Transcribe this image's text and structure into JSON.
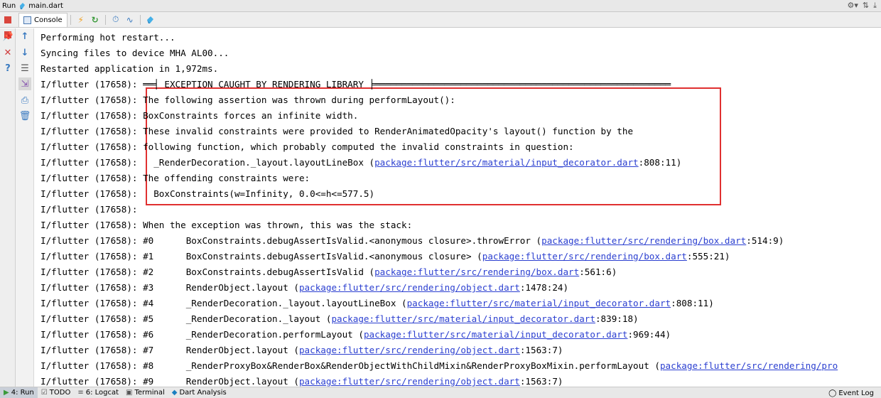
{
  "titlebar": {
    "run_label": "Run",
    "file_label": "main.dart",
    "icons": [
      "gear-icon",
      "split-icon",
      "minimize-icon"
    ]
  },
  "toolbar": {
    "console_tab": "Console",
    "buttons": [
      "flash-icon",
      "hot-restart-icon",
      "timer-icon",
      "performance-icon",
      "dart-devtools-icon"
    ]
  },
  "gutter_left": [
    "stop-icon",
    "pin-icon",
    "close-icon",
    "help-icon"
  ],
  "gutter_right": [
    "up-arrow-icon",
    "down-arrow-icon",
    "soft-wrap-icon",
    "scroll-end-icon",
    "print-icon",
    "trash-icon"
  ],
  "console_lines": [
    {
      "text": "Performing hot restart..."
    },
    {
      "text": "Syncing files to device MHA AL00..."
    },
    {
      "text": "Restarted application in 1,972ms."
    },
    {
      "prefix": "I/flutter (17658): ",
      "text": "══╡ EXCEPTION CAUGHT BY RENDERING LIBRARY ╞═══════════════════════════════════════════════════════"
    },
    {
      "prefix": "I/flutter (17658): ",
      "text": "The following assertion was thrown during performLayout():"
    },
    {
      "prefix": "I/flutter (17658): ",
      "text": "BoxConstraints forces an infinite width."
    },
    {
      "prefix": "I/flutter (17658): ",
      "text": "These invalid constraints were provided to RenderAnimatedOpacity's layout() function by the"
    },
    {
      "prefix": "I/flutter (17658): ",
      "text": "following function, which probably computed the invalid constraints in question:"
    },
    {
      "prefix": "I/flutter (17658): ",
      "text": "  _RenderDecoration._layout.layoutLineBox (",
      "link": "package:flutter/src/material/input_decorator.dart",
      "suffix": ":808:11)"
    },
    {
      "prefix": "I/flutter (17658): ",
      "text": "The offending constraints were:"
    },
    {
      "prefix": "I/flutter (17658): ",
      "text": "  BoxConstraints(w=Infinity, 0.0<=h<=577.5)"
    },
    {
      "prefix": "I/flutter (17658): ",
      "text": ""
    },
    {
      "prefix": "I/flutter (17658): ",
      "text": "When the exception was thrown, this was the stack:"
    },
    {
      "prefix": "I/flutter (17658): ",
      "text": "#0      BoxConstraints.debugAssertIsValid.<anonymous closure>.throwError (",
      "link": "package:flutter/src/rendering/box.dart",
      "suffix": ":514:9)"
    },
    {
      "prefix": "I/flutter (17658): ",
      "text": "#1      BoxConstraints.debugAssertIsValid.<anonymous closure> (",
      "link": "package:flutter/src/rendering/box.dart",
      "suffix": ":555:21)"
    },
    {
      "prefix": "I/flutter (17658): ",
      "text": "#2      BoxConstraints.debugAssertIsValid (",
      "link": "package:flutter/src/rendering/box.dart",
      "suffix": ":561:6)"
    },
    {
      "prefix": "I/flutter (17658): ",
      "text": "#3      RenderObject.layout (",
      "link": "package:flutter/src/rendering/object.dart",
      "suffix": ":1478:24)"
    },
    {
      "prefix": "I/flutter (17658): ",
      "text": "#4      _RenderDecoration._layout.layoutLineBox (",
      "link": "package:flutter/src/material/input_decorator.dart",
      "suffix": ":808:11)"
    },
    {
      "prefix": "I/flutter (17658): ",
      "text": "#5      _RenderDecoration._layout (",
      "link": "package:flutter/src/material/input_decorator.dart",
      "suffix": ":839:18)"
    },
    {
      "prefix": "I/flutter (17658): ",
      "text": "#6      _RenderDecoration.performLayout (",
      "link": "package:flutter/src/material/input_decorator.dart",
      "suffix": ":969:44)"
    },
    {
      "prefix": "I/flutter (17658): ",
      "text": "#7      RenderObject.layout (",
      "link": "package:flutter/src/rendering/object.dart",
      "suffix": ":1563:7)"
    },
    {
      "prefix": "I/flutter (17658): ",
      "text": "#8      _RenderProxyBox&RenderBox&RenderObjectWithChildMixin&RenderProxyBoxMixin.performLayout (",
      "link": "package:flutter/src/rendering/pro",
      "suffix": ""
    },
    {
      "prefix": "I/flutter (17658): ",
      "text": "#9      RenderObject.layout (",
      "link": "package:flutter/src/rendering/object.dart",
      "suffix": ":1563:7)"
    }
  ],
  "statusbar": {
    "items": [
      {
        "icon": "run-icon",
        "label": "4: Run",
        "active": true
      },
      {
        "icon": "todo-icon",
        "label": "TODO",
        "active": false
      },
      {
        "icon": "logcat-icon",
        "label": "6: Logcat",
        "active": false
      },
      {
        "icon": "terminal-icon",
        "label": "Terminal",
        "active": false
      },
      {
        "icon": "dart-analysis-icon",
        "label": "Dart Analysis",
        "active": false
      }
    ],
    "event_log": "Event Log"
  },
  "colors": {
    "link": "#2b3fd0",
    "highlight": "#e03030",
    "stop": "#d9453d"
  }
}
